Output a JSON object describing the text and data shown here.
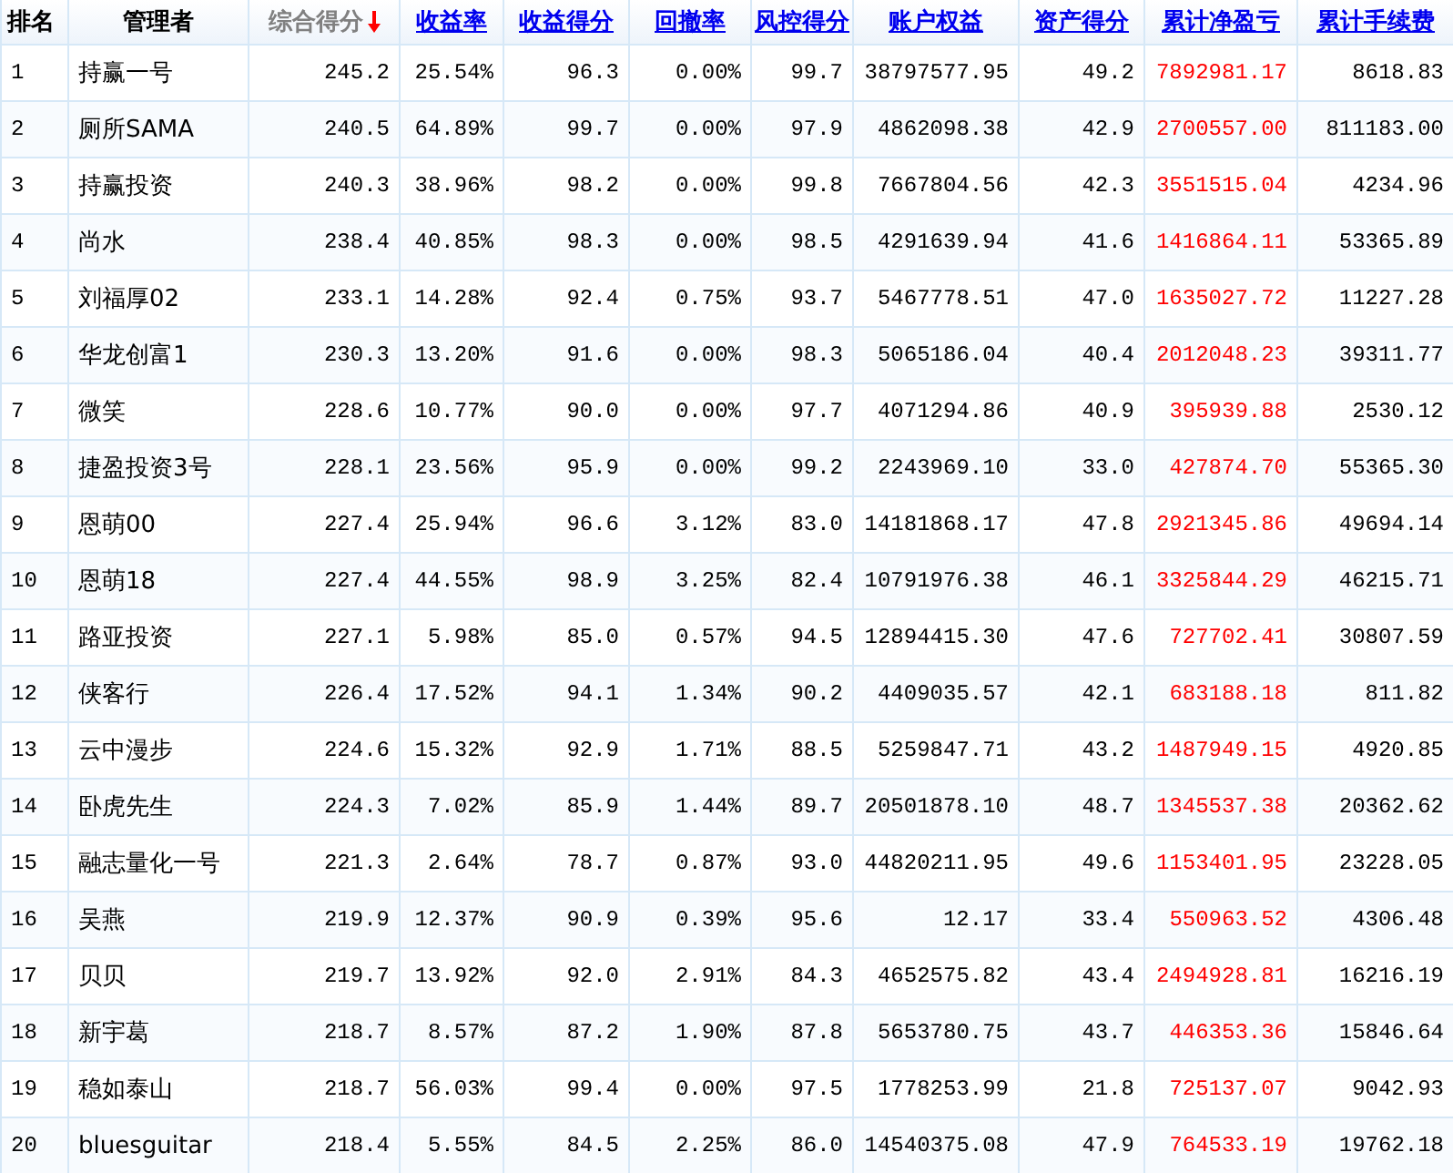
{
  "table": {
    "columns": [
      {
        "label": "排名",
        "kind": "plain"
      },
      {
        "label": "管理者",
        "kind": "plain"
      },
      {
        "label": "综合得分",
        "kind": "sorted"
      },
      {
        "label": "收益率",
        "kind": "link"
      },
      {
        "label": "收益得分",
        "kind": "link"
      },
      {
        "label": "回撤率",
        "kind": "link"
      },
      {
        "label": "风控得分",
        "kind": "link"
      },
      {
        "label": "账户权益",
        "kind": "link"
      },
      {
        "label": "资产得分",
        "kind": "link"
      },
      {
        "label": "累计净盈亏",
        "kind": "link",
        "color": "#ff0000"
      },
      {
        "label": "累计手续费",
        "kind": "link"
      }
    ],
    "rows": [
      [
        "1",
        "持赢一号",
        "245.2",
        "25.54%",
        "96.3",
        "0.00%",
        "99.7",
        "38797577.95",
        "49.2",
        "7892981.17",
        "8618.83"
      ],
      [
        "2",
        "厕所SAMA",
        "240.5",
        "64.89%",
        "99.7",
        "0.00%",
        "97.9",
        "4862098.38",
        "42.9",
        "2700557.00",
        "811183.00"
      ],
      [
        "3",
        "持赢投资",
        "240.3",
        "38.96%",
        "98.2",
        "0.00%",
        "99.8",
        "7667804.56",
        "42.3",
        "3551515.04",
        "4234.96"
      ],
      [
        "4",
        "尚水",
        "238.4",
        "40.85%",
        "98.3",
        "0.00%",
        "98.5",
        "4291639.94",
        "41.6",
        "1416864.11",
        "53365.89"
      ],
      [
        "5",
        "刘福厚02",
        "233.1",
        "14.28%",
        "92.4",
        "0.75%",
        "93.7",
        "5467778.51",
        "47.0",
        "1635027.72",
        "11227.28"
      ],
      [
        "6",
        "华龙创富1",
        "230.3",
        "13.20%",
        "91.6",
        "0.00%",
        "98.3",
        "5065186.04",
        "40.4",
        "2012048.23",
        "39311.77"
      ],
      [
        "7",
        "微笑",
        "228.6",
        "10.77%",
        "90.0",
        "0.00%",
        "97.7",
        "4071294.86",
        "40.9",
        "395939.88",
        "2530.12"
      ],
      [
        "8",
        "捷盈投资3号",
        "228.1",
        "23.56%",
        "95.9",
        "0.00%",
        "99.2",
        "2243969.10",
        "33.0",
        "427874.70",
        "55365.30"
      ],
      [
        "9",
        "恩萌00",
        "227.4",
        "25.94%",
        "96.6",
        "3.12%",
        "83.0",
        "14181868.17",
        "47.8",
        "2921345.86",
        "49694.14"
      ],
      [
        "10",
        "恩萌18",
        "227.4",
        "44.55%",
        "98.9",
        "3.25%",
        "82.4",
        "10791976.38",
        "46.1",
        "3325844.29",
        "46215.71"
      ],
      [
        "11",
        "路亚投资",
        "227.1",
        "5.98%",
        "85.0",
        "0.57%",
        "94.5",
        "12894415.30",
        "47.6",
        "727702.41",
        "30807.59"
      ],
      [
        "12",
        "侠客行",
        "226.4",
        "17.52%",
        "94.1",
        "1.34%",
        "90.2",
        "4409035.57",
        "42.1",
        "683188.18",
        "811.82"
      ],
      [
        "13",
        "云中漫步",
        "224.6",
        "15.32%",
        "92.9",
        "1.71%",
        "88.5",
        "5259847.71",
        "43.2",
        "1487949.15",
        "4920.85"
      ],
      [
        "14",
        "卧虎先生",
        "224.3",
        "7.02%",
        "85.9",
        "1.44%",
        "89.7",
        "20501878.10",
        "48.7",
        "1345537.38",
        "20362.62"
      ],
      [
        "15",
        "融志量化一号",
        "221.3",
        "2.64%",
        "78.7",
        "0.87%",
        "93.0",
        "44820211.95",
        "49.6",
        "1153401.95",
        "23228.05"
      ],
      [
        "16",
        "吴燕",
        "219.9",
        "12.37%",
        "90.9",
        "0.39%",
        "95.6",
        "12.17",
        "33.4",
        "550963.52",
        "4306.48"
      ],
      [
        "17",
        "贝贝",
        "219.7",
        "13.92%",
        "92.0",
        "2.91%",
        "84.3",
        "4652575.82",
        "43.4",
        "2494928.81",
        "16216.19"
      ],
      [
        "18",
        "新宇葛",
        "218.7",
        "8.57%",
        "87.2",
        "1.90%",
        "87.8",
        "5653780.75",
        "43.7",
        "446353.36",
        "15846.64"
      ],
      [
        "19",
        "稳如泰山",
        "218.7",
        "56.03%",
        "99.4",
        "0.00%",
        "97.5",
        "1778253.99",
        "21.8",
        "725137.07",
        "9042.93"
      ],
      [
        "20",
        "bluesguitar",
        "218.4",
        "5.55%",
        "84.5",
        "2.25%",
        "86.0",
        "14540375.08",
        "47.9",
        "764533.19",
        "19762.18"
      ]
    ]
  }
}
